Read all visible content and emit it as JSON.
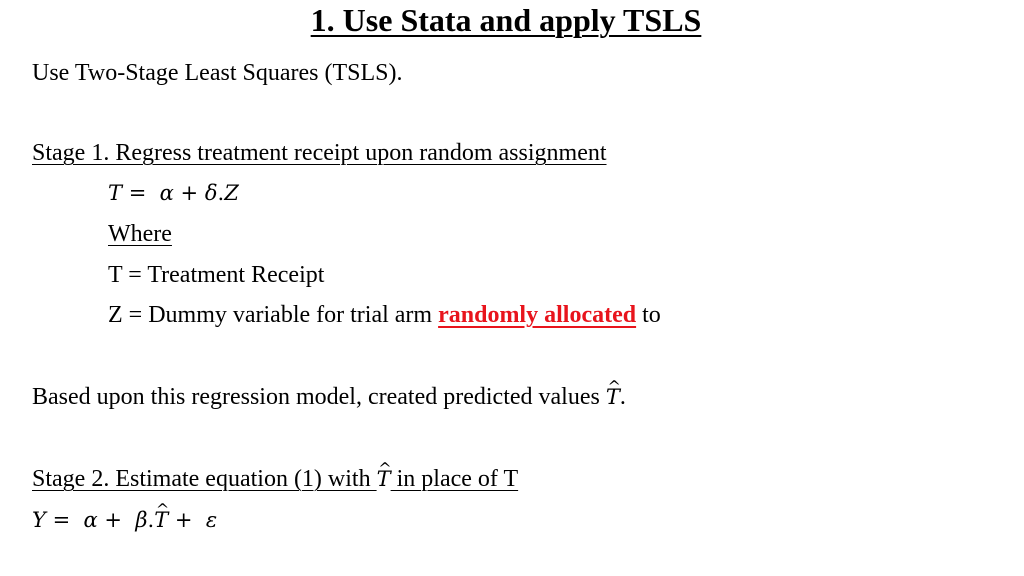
{
  "slide": {
    "title": "1. Use Stata and apply TSLS",
    "intro": "Use Two-Stage Least Squares (TSLS).",
    "stage1": {
      "heading": "Stage 1. Regress treatment receipt upon random assignment",
      "equation": {
        "lhs": "T",
        "eq": "=",
        "alpha": "α",
        "plus": "+",
        "delta": "δ",
        "dot": ".",
        "z": "Z"
      },
      "where_label": "Where",
      "def_t": "T = Treatment Receipt",
      "def_z_prefix": "Z = Dummy variable for trial arm ",
      "def_z_emphasis": "randomly allocated",
      "def_z_suffix": " to"
    },
    "predicted": {
      "text": "Based upon this regression model, created predicted values ",
      "symbol": "T",
      "suffix": "."
    },
    "stage2": {
      "heading_prefix": "Stage 2. Estimate equation (1) with ",
      "heading_symbol": "T",
      "heading_suffix": " in place of T",
      "equation": {
        "lhs": "Y",
        "eq": "=",
        "alpha": "α",
        "plus1": "+",
        "beta": "β",
        "dot": ".",
        "that": "T",
        "plus2": "+",
        "epsilon": "ε"
      }
    },
    "colors": {
      "emphasis": "#e8141c",
      "text": "#000000",
      "background": "#ffffff"
    }
  }
}
